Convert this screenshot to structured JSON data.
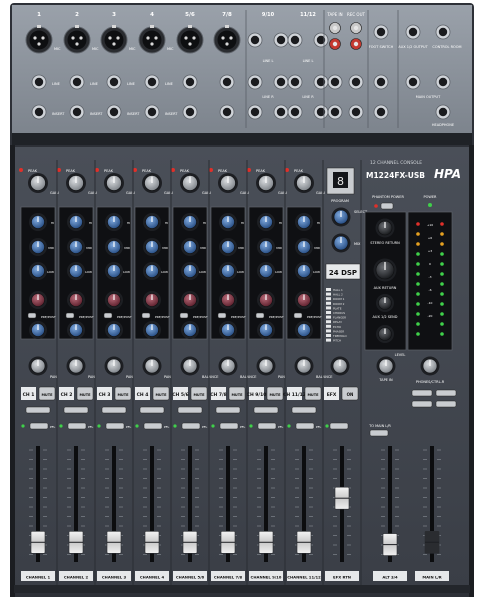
{
  "brand": {
    "name": "HPA",
    "model": "M1224FX-USB",
    "subtitle": "12 CHANNEL CONSOLE"
  },
  "rear_panel": {
    "jack_labels": [
      "1",
      "2",
      "3",
      "4",
      "5/6",
      "7/8",
      "9/10",
      "11/12",
      "TAPE IN",
      "REC OUT"
    ],
    "right_labels": [
      "FOOT SWITCH",
      "AUX 1/2 OUTPUT",
      "CONTROL ROOM",
      "MAIN OUTPUT",
      "HEADPHONE"
    ],
    "row_labels": [
      "MIC",
      "LINE",
      "INSERT",
      "LINE L",
      "LINE R"
    ]
  },
  "channels": [
    {
      "strip_label": "CHANNEL 1",
      "number": "CH 1",
      "pan_label": "PAN",
      "fader_level": 0.17
    },
    {
      "strip_label": "CHANNEL 2",
      "number": "CH 2",
      "pan_label": "PAN",
      "fader_level": 0.17
    },
    {
      "strip_label": "CHANNEL 3",
      "number": "CH 3",
      "pan_label": "PAN",
      "fader_level": 0.17
    },
    {
      "strip_label": "CHANNEL 4",
      "number": "CH 4",
      "pan_label": "PAN",
      "fader_level": 0.17
    },
    {
      "strip_label": "CHANNEL 5/6",
      "number": "CH 5/6",
      "pan_label": "BALANCE",
      "fader_level": 0.17
    },
    {
      "strip_label": "CHANNEL 7/8",
      "number": "CH 7/8",
      "pan_label": "BALANCE",
      "fader_level": 0.17
    },
    {
      "strip_label": "CHANNEL 9/10",
      "number": "CH 9/10",
      "pan_label": "PAN",
      "fader_level": 0.17
    },
    {
      "strip_label": "CHANNEL 11/12",
      "number": "CH 11/12",
      "pan_label": "BALANCE",
      "fader_level": 0.17
    }
  ],
  "knob_labels": {
    "gain": "GAIN",
    "high": "HI",
    "mid": "MID",
    "low": "LOW",
    "aux1": "AUX 1",
    "aux2": "AUX 2",
    "prepost": "PRE/POST",
    "peak": "PEAK",
    "mute": "MUTE",
    "alt": "ALT 3/4",
    "pfl": "PFL"
  },
  "efx": {
    "strip_label": "EFX RTN",
    "fx_label": "EFX",
    "on_label": "ON",
    "display": "24 DSP",
    "program_label": "PROGRAM",
    "select_label": "SELECT",
    "mix_label": "MIX",
    "fader_level": 0.55,
    "presets": [
      "HALL 1",
      "HALL 2",
      "ROOM 1",
      "ROOM 2",
      "PLATE",
      "CHORUS",
      "FLANGER",
      "DELAY",
      "ECHO",
      "PHASER",
      "TREMOLO",
      "PITCH"
    ]
  },
  "master": {
    "phantom": "PHANTOM POWER",
    "power": "POWER",
    "stereo_return": "STEREO RETURN",
    "aux_returns": "AUX RETURN",
    "aux12_send": "AUX 1/2 SEND",
    "tape_in": "TAPE IN",
    "level": "LEVEL",
    "phones": "PHONES/CTRL-R",
    "to_main": "TO MAIN L/R",
    "alt_strip_label": "ALT 3/4",
    "main_strip_label": "MAIN L/R",
    "meter_labels": [
      "+10",
      "+6",
      "+3",
      "0",
      "-3",
      "-6",
      "-10",
      "-20"
    ],
    "alt_fader_level": 0.15,
    "main_fader_level": 0.17
  },
  "colors": {
    "panel": "#3f434c",
    "rear": "#8f969f",
    "knob_blue": "#2f5f9f",
    "knob_red": "#7a2c3c",
    "led_green": "#3fd04a",
    "led_red": "#e0302a"
  }
}
